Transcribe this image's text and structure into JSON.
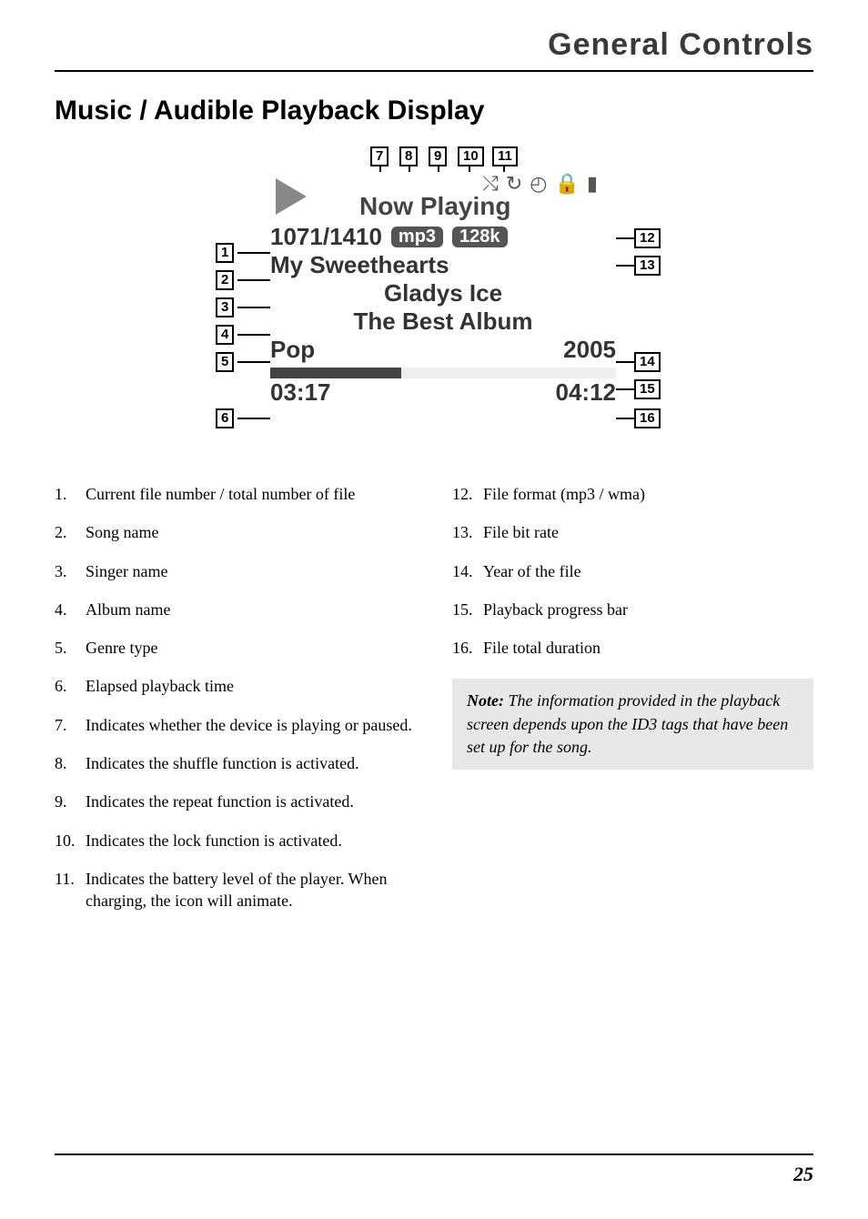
{
  "page": {
    "header": "General Controls",
    "section_title": "Music / Audible Playback Display",
    "number": "25"
  },
  "screen": {
    "now_playing_label": "Now Playing",
    "file_counter": "1071/1410",
    "format_chip": "mp3",
    "bitrate_chip": "128k",
    "song": "My Sweethearts",
    "artist": "Gladys Ice",
    "album": "The Best Album",
    "genre": "Pop",
    "year": "2005",
    "elapsed": "03:17",
    "duration": "04:12"
  },
  "callouts": {
    "c1": "1",
    "c2": "2",
    "c3": "3",
    "c4": "4",
    "c5": "5",
    "c6": "6",
    "c7": "7",
    "c8": "8",
    "c9": "9",
    "c10": "10",
    "c11": "11",
    "c12": "12",
    "c13": "13",
    "c14": "14",
    "c15": "15",
    "c16": "16"
  },
  "legend_left": [
    {
      "n": "1.",
      "t": "Current file number / total number of file"
    },
    {
      "n": "2.",
      "t": "Song name"
    },
    {
      "n": "3.",
      "t": "Singer name"
    },
    {
      "n": "4.",
      "t": "Album name"
    },
    {
      "n": "5.",
      "t": "Genre type"
    },
    {
      "n": "6.",
      "t": "Elapsed playback time"
    },
    {
      "n": "7.",
      "t": "Indicates whether the device is playing or paused."
    },
    {
      "n": "8.",
      "t": "Indicates the shuffle function is activated."
    },
    {
      "n": "9.",
      "t": "Indicates the repeat function is activated."
    },
    {
      "n": "10.",
      "t": "Indicates the lock function is activated."
    },
    {
      "n": "11.",
      "t": "Indicates the battery level of the player. When charging, the icon will animate."
    }
  ],
  "legend_right": [
    {
      "n": "12.",
      "t": "File format (mp3 / wma)"
    },
    {
      "n": "13.",
      "t": "File bit rate"
    },
    {
      "n": "14.",
      "t": "Year of the file"
    },
    {
      "n": "15.",
      "t": "Playback progress bar"
    },
    {
      "n": "16.",
      "t": "File total duration"
    }
  ],
  "note": {
    "label": "Note:",
    "text": " The information provided in the playback screen depends upon the ID3 tags that have been set up for the song."
  }
}
